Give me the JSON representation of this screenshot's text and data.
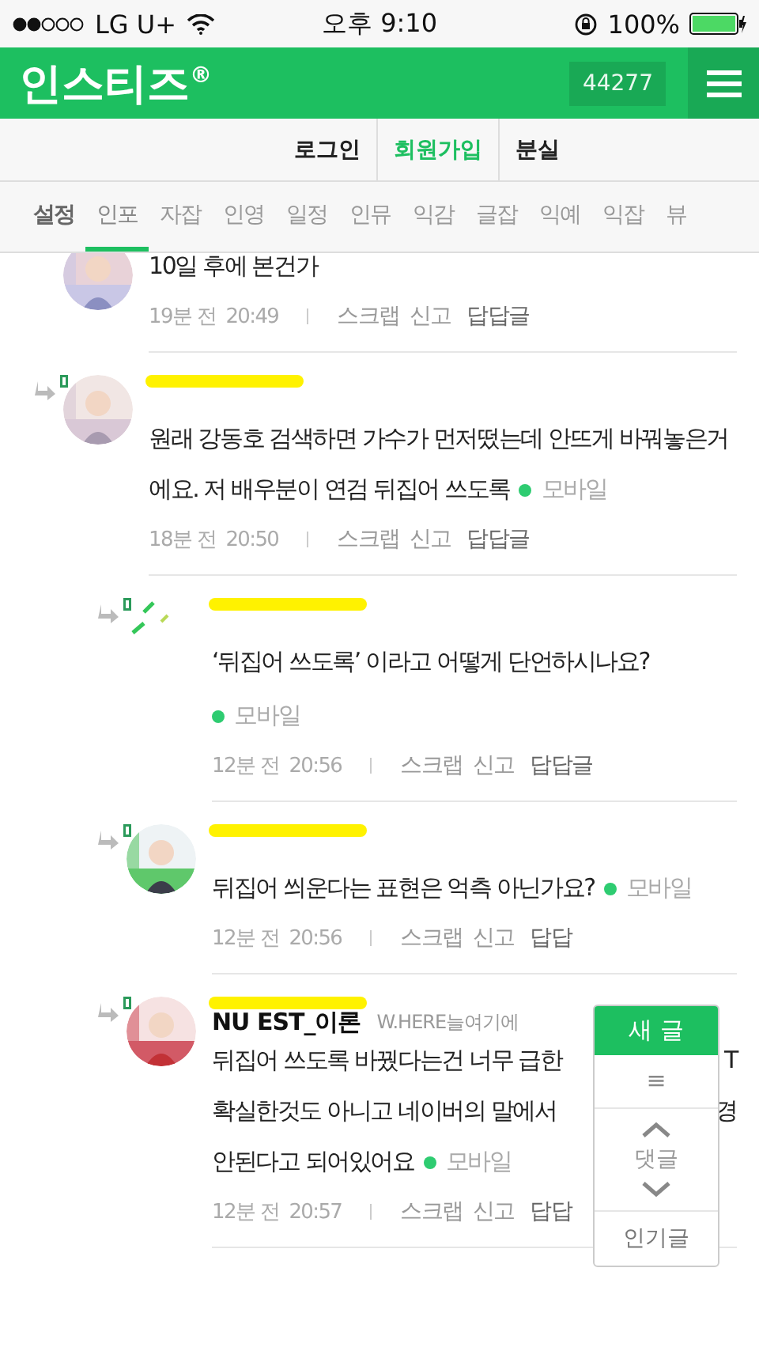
{
  "status_bar": {
    "carrier": "LG U+",
    "time": "오후 9:10",
    "battery": "100%"
  },
  "header": {
    "logo": "인스티즈$^{®}$",
    "counter": "44277"
  },
  "account_links": [
    {
      "label": "로그인",
      "selected": false
    },
    {
      "label": "회원가입",
      "selected": true
    },
    {
      "label": "분실",
      "selected": false
    }
  ],
  "tabs": [
    {
      "label": "설정",
      "kind": "settings",
      "selected": false
    },
    {
      "label": "인포",
      "kind": "board",
      "selected": true
    },
    {
      "label": "자잡",
      "kind": "board",
      "selected": false
    },
    {
      "label": "인영",
      "kind": "board",
      "selected": false
    },
    {
      "label": "일정",
      "kind": "board",
      "selected": false
    },
    {
      "label": "인뮤",
      "kind": "board",
      "selected": false
    },
    {
      "label": "익감",
      "kind": "board",
      "selected": false
    },
    {
      "label": "글잡",
      "kind": "board",
      "selected": false
    },
    {
      "label": "익예",
      "kind": "board",
      "selected": false
    },
    {
      "label": "익잡",
      "kind": "board",
      "selected": false
    },
    {
      "label": "뷰",
      "kind": "board",
      "selected": false
    }
  ],
  "comments": [
    {
      "arrow": false,
      "redacted": false,
      "lines": [
        [
          "10일 후에 본건가"
        ]
      ],
      "ago": "19분 전",
      "time": "20:49",
      "actions": [
        "스크랩",
        "신고",
        "답답글"
      ]
    },
    {
      "arrow": true,
      "redacted": true,
      "body": "원래 강동호 검색하면 가수가 먼저떴는데 안뜨게 바꿔놓은거에요. 저 배우분이 연검 뒤집어 쓰도록",
      "mobile": "모바일",
      "ago": "18분 전",
      "time": "20:50",
      "actions": [
        "스크랩",
        "신고",
        "답답글"
      ],
      "children": [
        {
          "arrow": true,
          "redacted": true,
          "broken_avatar": true,
          "body": "‘뒤집어 쓰도록’ 이라고 어떻게 단언하시나요?",
          "mobile": "모바일",
          "mobile_block": true,
          "ago": "12분 전",
          "time": "20:56",
          "actions": [
            "스크랩",
            "신고",
            "답답글"
          ]
        },
        {
          "arrow": true,
          "redacted": true,
          "body": "뒤집어 씌운다는 표현은 억측 아닌가요?",
          "mobile": "모바일",
          "ago": "12분 전",
          "time": "20:56",
          "actions": [
            "스크랩",
            "신고",
            "답답"
          ]
        },
        {
          "arrow": true,
          "redacted": true,
          "name": "NU EST_이론",
          "tag": "W.HERE늘여기에",
          "lines": [
            [
              "뒤집어 쓰도록 바꿨다는건 너무 급한",
              "T"
            ],
            [
              "확실한것도 아니고 네이버의 말에서",
              "경"
            ],
            [
              "안된다고 되어있어요"
            ]
          ],
          "mobile": "모바일",
          "ago": "12분 전",
          "time": "20:57",
          "actions": [
            "스크랩",
            "신고",
            "답답"
          ]
        }
      ]
    }
  ],
  "float_panel": {
    "new_post": "새 글",
    "list": "≡",
    "comments": "댓글",
    "popular": "인기글"
  }
}
